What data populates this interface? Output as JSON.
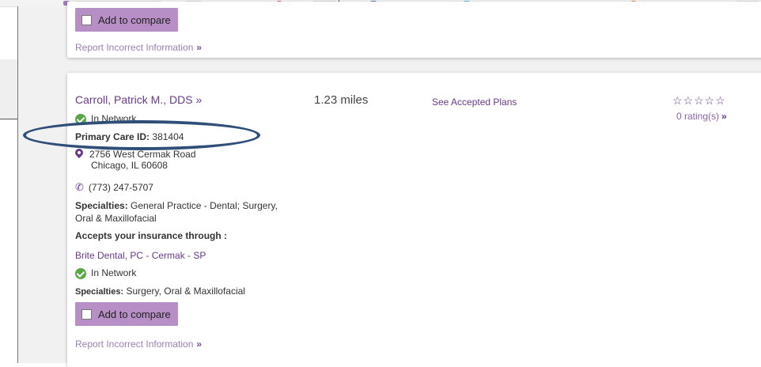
{
  "colors": {
    "accent": "#6a3a8c",
    "compare_button": "#b78fc6",
    "in_network_green": "#5aa845",
    "annotation_ellipse": "#2f4f78"
  },
  "top_card": {
    "compare_label": "Add to compare",
    "report_label": "Report Incorrect Information",
    "report_arrow": "»"
  },
  "provider": {
    "name": "Carroll, Patrick M., DDS",
    "name_arrow": "»",
    "distance": "1.23 miles",
    "accepted_plans_link": "See Accepted Plans",
    "rating_stars": "☆☆☆☆☆",
    "rating_text": "0 rating(s)",
    "rating_arrow": "»",
    "network_status": "In Network",
    "primary_care_label": "Primary Care ID:",
    "primary_care_id": "381404",
    "address_line1": "2756 West Cermak Road",
    "address_line2": "Chicago, IL 60608",
    "phone": "(773) 247-5707",
    "specialties_label": "Specialties:",
    "specialties_line1": "General Practice - Dental; Surgery,",
    "specialties_line2": "Oral & Maxillofacial",
    "accepts_label": "Accepts your insurance through :",
    "group_name": "Brite Dental, PC - Cermak - SP",
    "group_network_status": "In Network",
    "group_specialties_label": "Specialties:",
    "group_specialties": "Surgery, Oral & Maxillofacial",
    "compare_label": "Add to compare",
    "report_label": "Report Incorrect Information",
    "report_arrow": "»"
  },
  "icons": [
    "checkbox-icon",
    "check-circle-icon",
    "map-pin-icon",
    "phone-icon",
    "star-outline-icon"
  ]
}
